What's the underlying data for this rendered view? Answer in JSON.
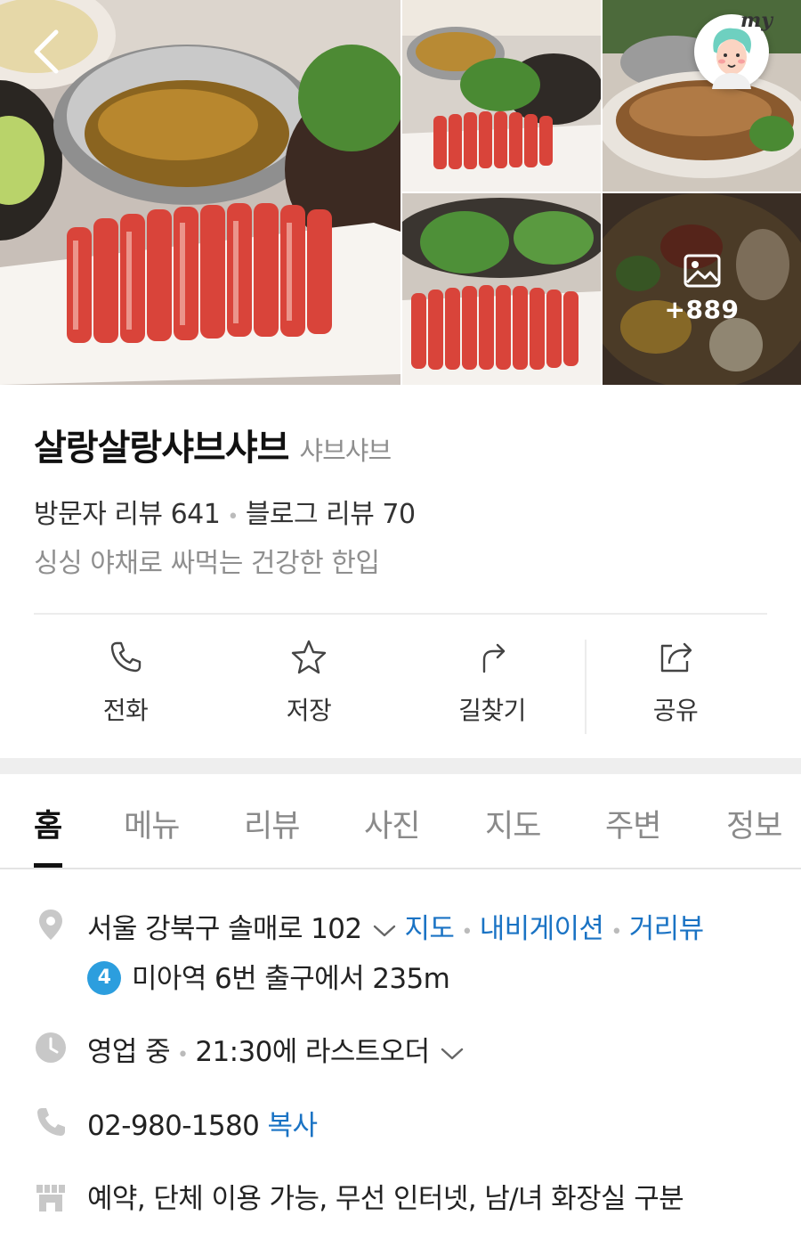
{
  "gallery": {
    "more_count": "+889",
    "my_label": "my"
  },
  "place": {
    "name": "살랑살랑샤브샤브",
    "category": "샤브샤브",
    "visitor_reviews": "방문자 리뷰 641",
    "blog_reviews": "블로그 리뷰 70",
    "tagline": "싱싱 야채로 싸먹는 건강한 한입"
  },
  "actions": [
    {
      "label": "전화",
      "icon": "phone-icon"
    },
    {
      "label": "저장",
      "icon": "star-icon"
    },
    {
      "label": "길찾기",
      "icon": "directions-icon"
    },
    {
      "label": "공유",
      "icon": "share-icon"
    }
  ],
  "tabs": [
    "홈",
    "메뉴",
    "리뷰",
    "사진",
    "지도",
    "주변",
    "정보"
  ],
  "active_tab": "홈",
  "info": {
    "address": "서울 강북구 솔매로 102",
    "map_link": "지도",
    "navigation_link": "내비게이션",
    "streetview_link": "거리뷰",
    "subway_line": "4",
    "subway_text": "미아역 6번 출구에서 235m",
    "hours_status": "영업 중",
    "hours_detail": "21:30에 라스트오더",
    "phone": "02-980-1580",
    "copy_label": "복사",
    "amenities": "예약, 단체 이용 가능, 무선 인터넷, 남/녀 화장실 구분"
  },
  "colors": {
    "link": "#1a73c4",
    "subway_line_4": "#2c9ede",
    "tab_active": "#111111",
    "tab_inactive": "#8a8a8a"
  }
}
